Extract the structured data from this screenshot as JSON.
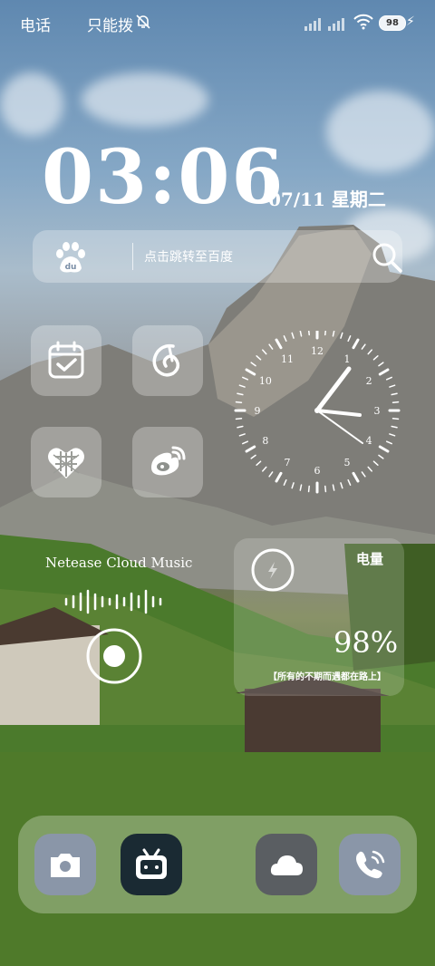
{
  "status_bar": {
    "carrier": "电话",
    "mode": "只能拨",
    "battery_level": "98",
    "icons": [
      "bell-off-icon",
      "signal-icon",
      "signal-icon",
      "wifi-icon",
      "battery-icon",
      "charging-icon"
    ]
  },
  "clock_widget": {
    "time": "03:06",
    "date": "07/11 星期二"
  },
  "search_widget": {
    "logo": "baidu-paw-icon",
    "prompt": "点击跳转至百度",
    "icon": "search-icon"
  },
  "app_tiles": [
    {
      "name": "calendar-check-icon"
    },
    {
      "name": "netease-music-icon"
    },
    {
      "name": "heart-grid-icon"
    },
    {
      "name": "weibo-icon"
    }
  ],
  "analog_clock": {
    "numbers": [
      "12",
      "1",
      "2",
      "3",
      "4",
      "5",
      "6",
      "7",
      "8",
      "9",
      "10",
      "11"
    ]
  },
  "music_widget": {
    "title": "Netease Cloud Music"
  },
  "battery_widget": {
    "label": "电量",
    "percent": "98%",
    "quote": "【所有的不期而遇都在路上】"
  },
  "dock": {
    "apps": [
      "camera-icon",
      "bilibili-icon",
      "weather-icon",
      "phone-icon"
    ]
  },
  "colors": {
    "dock_bilibili_bg": "#1a2a33",
    "dock_weather_bg": "#5a5e62",
    "dock_camera_bg": "#8a96a8",
    "dock_phone_bg": "#8a96a8"
  }
}
